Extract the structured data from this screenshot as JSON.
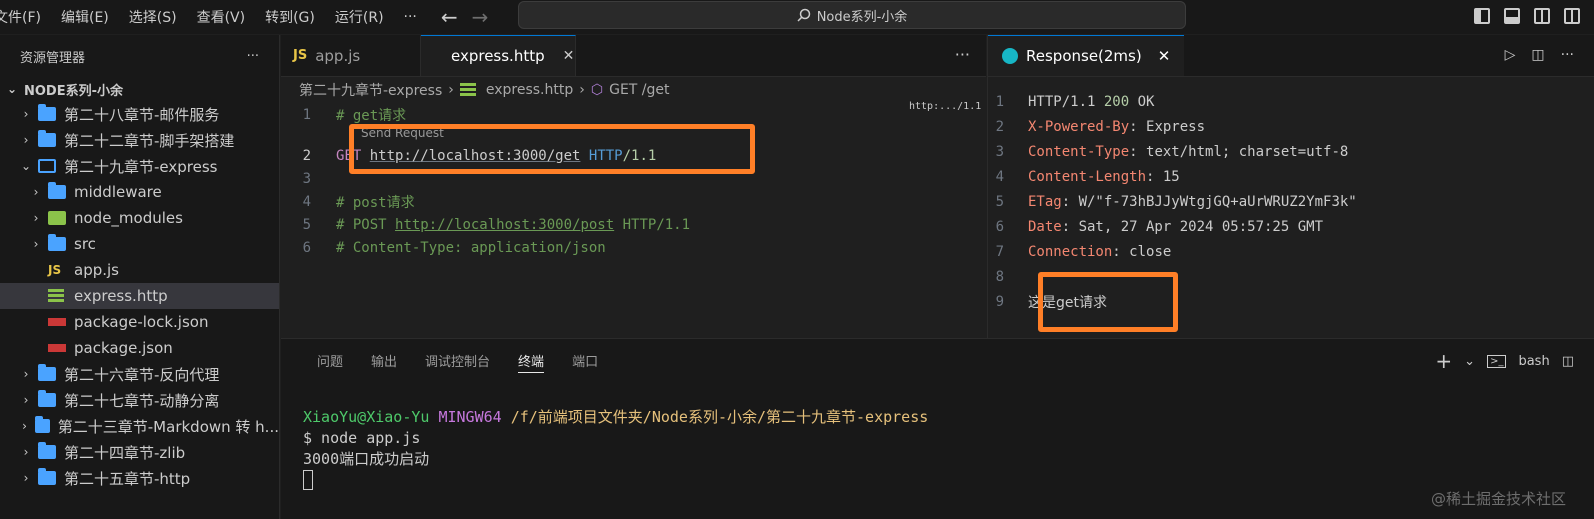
{
  "menu": [
    "文件(F)",
    "编辑(E)",
    "选择(S)",
    "查看(V)",
    "转到(G)",
    "运行(R)",
    "···"
  ],
  "command_center": "Node系列-小余",
  "sidebar": {
    "title": "资源管理器",
    "more": "···",
    "root": "NODE系列-小余",
    "items": [
      {
        "label": "第二十八章节-邮件服务",
        "type": "folder"
      },
      {
        "label": "第二十二章节-脚手架搭建",
        "type": "folder"
      },
      {
        "label": "第二十九章节-express",
        "type": "folder-open"
      },
      {
        "label": "middleware",
        "type": "folder"
      },
      {
        "label": "node_modules",
        "type": "folder-nm"
      },
      {
        "label": "src",
        "type": "folder"
      },
      {
        "label": "app.js",
        "type": "js"
      },
      {
        "label": "express.http",
        "type": "http"
      },
      {
        "label": "package-lock.json",
        "type": "npm"
      },
      {
        "label": "package.json",
        "type": "npm"
      },
      {
        "label": "第二十六章节-反向代理",
        "type": "folder"
      },
      {
        "label": "第二十七章节-动静分离",
        "type": "folder"
      },
      {
        "label": "第二十三章节-Markdown 转 h...",
        "type": "folder"
      },
      {
        "label": "第二十四章节-zlib",
        "type": "folder"
      },
      {
        "label": "第二十五章节-http",
        "type": "folder"
      }
    ]
  },
  "editor": {
    "tabs": [
      {
        "label": "app.js",
        "icon": "JS"
      },
      {
        "label": "express.http",
        "icon": "http"
      }
    ],
    "breadcrumb": [
      "第二十九章节-express",
      "express.http",
      "GET /get"
    ],
    "send_request": "Send Request",
    "minimap_label": "http:.../1.1",
    "lines": [
      {
        "n": "1",
        "text": "# get请求"
      },
      {
        "n": "2",
        "method": "GET",
        "url": "http://localhost:3000/get",
        "proto": "HTTP",
        "ver": "/1.1"
      },
      {
        "n": "3",
        "text": ""
      },
      {
        "n": "4",
        "text": "# post请求"
      },
      {
        "n": "5",
        "text": "# POST",
        "url": "http://localhost:3000/post",
        "tail": "HTTP/1.1"
      },
      {
        "n": "6",
        "text": "# Content-Type: application/json"
      }
    ]
  },
  "response": {
    "tab_label": "Response(2ms)",
    "lines": [
      {
        "n": "1",
        "a": "HTTP/1.1 ",
        "b": "200",
        "c": " OK"
      },
      {
        "n": "2",
        "k": "X-Powered-By",
        "v": ": Express"
      },
      {
        "n": "3",
        "k": "Content-Type",
        "v": ": text/html; charset=utf-8"
      },
      {
        "n": "4",
        "k": "Content-Length",
        "v": ": 15"
      },
      {
        "n": "5",
        "k": "ETag",
        "v": ": W/\"f-73hBJJyWtgjGQ+aUrWRUZ2YmF3k\""
      },
      {
        "n": "6",
        "k": "Date",
        "v": ": Sat, 27 Apr 2024 05:57:25 GMT"
      },
      {
        "n": "7",
        "k": "Connection",
        "v": ": close"
      },
      {
        "n": "8",
        "body": ""
      },
      {
        "n": "9",
        "body": "这是get请求"
      }
    ]
  },
  "panel": {
    "tabs": [
      "问题",
      "输出",
      "调试控制台",
      "终端",
      "端口"
    ],
    "active_tab": "终端",
    "shell": "bash",
    "terminal": {
      "user": "XiaoYu@Xiao-Yu",
      "host": "MINGW64",
      "path": "/f/前端项目文件夹/Node系列-小余/第二十九章节-express",
      "command": "$ node app.js",
      "output": "3000端口成功启动"
    }
  },
  "watermark": "@稀土掘金技术社区",
  "colors": {
    "accent": "#0078d4",
    "highlight": "#ff7f27"
  }
}
